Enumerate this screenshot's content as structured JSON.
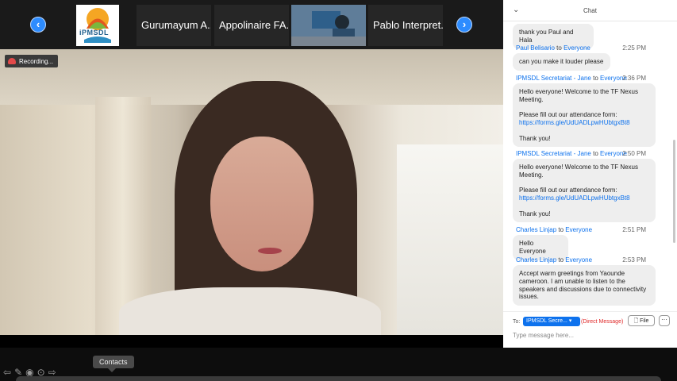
{
  "participants": {
    "tiles": [
      {
        "name": "Gurumayum A..."
      },
      {
        "name": "Appolinaire FA..."
      },
      {
        "name": "Pablo Interpret..."
      }
    ],
    "logo_text": "iPMSDL"
  },
  "recording": {
    "label": "Recording..."
  },
  "chat": {
    "title": "Chat",
    "messages": [
      {
        "text": "thank you Paul and Hala"
      },
      {
        "sender": "Paul Belisario",
        "to_word": "to",
        "recipient": "Everyone",
        "time": "2:25 PM",
        "text": "can you make it louder please"
      },
      {
        "sender": "IPMSDL Secretariat - Jane",
        "to_word": "to",
        "recipient": "Everyone",
        "time": "2:36 PM",
        "text_a": "Hello everyone! Welcome to the TF Nexus\nMeeting.\n\nPlease fill out our attendance form:",
        "link": "https://forms.gle/UdUADLpwHUbtgxBt8",
        "text_b": "Thank you!"
      },
      {
        "sender": "IPMSDL Secretariat - Jane",
        "to_word": "to",
        "recipient": "Everyone",
        "time": "2:50 PM",
        "text_a": "Hello everyone! Welcome to the TF Nexus\nMeeting.\n\nPlease fill out our attendance form:",
        "link": "https://forms.gle/UdUADLpwHUbtgxBt8",
        "text_b": "Thank you!"
      },
      {
        "sender": "Charles Linjap",
        "to_word": "to",
        "recipient": "Everyone",
        "time": "2:51 PM",
        "text": "Hello Everyone"
      },
      {
        "sender": "Charles Linjap",
        "to_word": "to",
        "recipient": "Everyone",
        "time": "2:53 PM",
        "text": "Accept warm greetings from Yaounde\ncameroon. I am unable to listen to the\nspeakers and discussions due to connectivity\nissues."
      }
    ],
    "composer": {
      "to_label": "To:",
      "recipient": "IPMSDL Secre...",
      "direct": "(Direct Message)",
      "file_label": "File",
      "more_label": "···",
      "placeholder": "Type message here..."
    }
  },
  "tooltip": {
    "text": "Contacts"
  },
  "colors": {
    "accent": "#0e72ed",
    "nav": "#2d8cff",
    "bubble": "#eeeeee",
    "warning": "#e02828"
  }
}
